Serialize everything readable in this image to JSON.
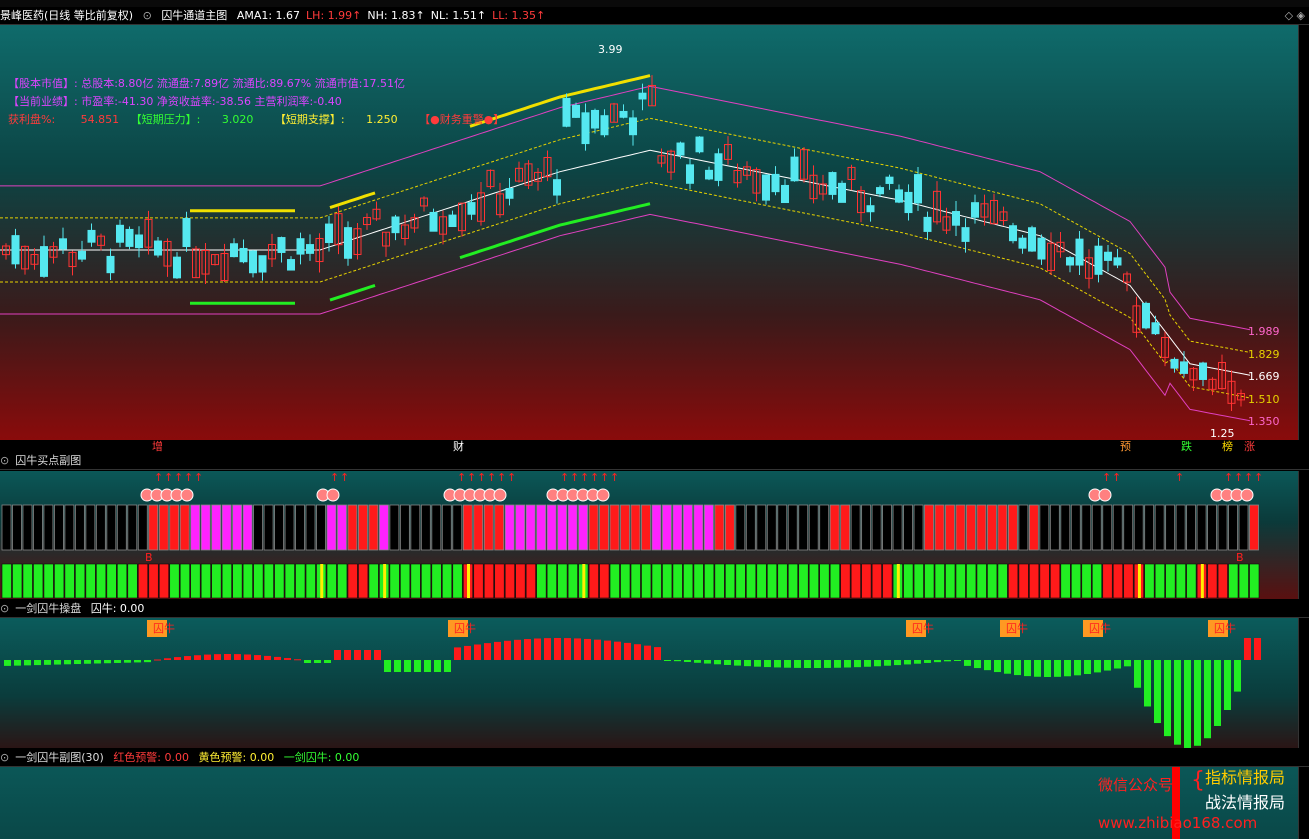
{
  "top_header": {
    "stock_title": "景峰医药(日线 等比前复权)",
    "indicator_name": "囚牛通道主图",
    "values": [
      {
        "label": "AMA1: 1.67",
        "color": "#ffffff"
      },
      {
        "label": "LH: 1.99",
        "color": "#ff3b3b"
      },
      {
        "label": "NH: 1.83",
        "color": "#ffffff"
      },
      {
        "label": "NL: 1.51",
        "color": "#ffffff"
      },
      {
        "label": "LL: 1.35",
        "color": "#ff3b3b"
      }
    ],
    "up_arrow": "↑"
  },
  "main_chart": {
    "info_rows": [
      {
        "title": "【股本市值】:",
        "text": "总股本:8.80亿 流通盘:7.89亿 流通比:89.67% 流通市值:17.51亿"
      },
      {
        "title": "【当前业绩】:",
        "text": "市盈率:-41.30 净资收益率:-38.56 主营利润率:-0.40"
      }
    ],
    "row3": {
      "profit_label": "获利盘%:",
      "profit_value": "54.851",
      "pressure_label": "【短期压力】:",
      "pressure_value": "3.020",
      "support_label": "【短期支撑】:",
      "support_value": "1.250",
      "warn_label": "【●财务重警●】"
    },
    "high_label": "3.99",
    "low_label": "1.25",
    "price_labels": [
      {
        "value": "1.989",
        "color": "#ff66cc"
      },
      {
        "value": "1.829",
        "color": "#e6d200"
      },
      {
        "value": "1.669",
        "color": "#ffffff"
      },
      {
        "value": "1.510",
        "color": "#e6d200"
      },
      {
        "value": "1.350",
        "color": "#ff66cc"
      }
    ],
    "bottom_markers": [
      {
        "text": "增",
        "color": "#ff3b3b"
      },
      {
        "text": "财",
        "color": "#ffffff"
      },
      {
        "text": "预",
        "color": "#ff9933"
      },
      {
        "text": "跌",
        "color": "#33ff33"
      },
      {
        "text": "榜",
        "color": "#ffdd00"
      },
      {
        "text": "涨",
        "color": "#ff3b3b"
      }
    ]
  },
  "panel2": {
    "title": "囚牛买点副图",
    "b_label": "B"
  },
  "panel3": {
    "title": "一剑囚牛操盘",
    "value": "囚牛: 0.00",
    "tag": "囚牛"
  },
  "panel4": {
    "title": "一剑囚牛副图(30)",
    "red_label": "红色预警: 0.00",
    "yellow_label": "黄色预警: 0.00",
    "green_label": "一剑囚牛: 0.00"
  },
  "watermark": {
    "wechat": "微信公众号",
    "line1": "指标情报局",
    "line2": "战法情报局",
    "site": "www.zhibiao168.com"
  },
  "colors": {
    "accent_red": "#ff1a1a",
    "magenta": "#ff22ff",
    "cyan_candle": "#55e8f0",
    "green_bar": "#22ee22"
  }
}
